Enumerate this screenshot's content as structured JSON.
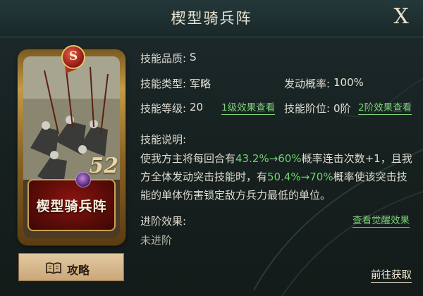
{
  "header": {
    "title": "楔型骑兵阵",
    "close_label": "X"
  },
  "card": {
    "rarity": "S",
    "name": "楔型骑兵阵",
    "level": "52"
  },
  "guide": {
    "label": "攻略"
  },
  "info": {
    "quality_label": "技能品质:",
    "quality_value": "S",
    "type_label": "技能类型:",
    "type_value": "军略",
    "prob_label": "发动概率:",
    "prob_value": "100%",
    "level_label": "技能等级:",
    "level_value": "20",
    "level_link": "1级效果查看",
    "stage_label": "技能阶位:",
    "stage_value": "0阶",
    "stage_link": "2阶效果查看"
  },
  "description": {
    "label": "技能说明:",
    "p1": "使我方主将每回合有",
    "h1": "43.2%→60%",
    "p2": "概率连击次数+1，且我方全体发动突击技能时，有",
    "h2": "50.4%→70%",
    "p3": "概率使该突击技能的单体伤害锁定敌方兵力最低的单位。"
  },
  "advance": {
    "label": "进阶效果:",
    "value": "未进阶",
    "awaken_link": "查看觉醒效果"
  },
  "footer": {
    "goto_label": "前往获取"
  },
  "colors": {
    "highlight": "#6fd36d",
    "panel_bg": "#1a2627",
    "card_plate": "#6a0e0a"
  },
  "icons": {
    "guide": "book-icon",
    "close": "close-icon"
  }
}
